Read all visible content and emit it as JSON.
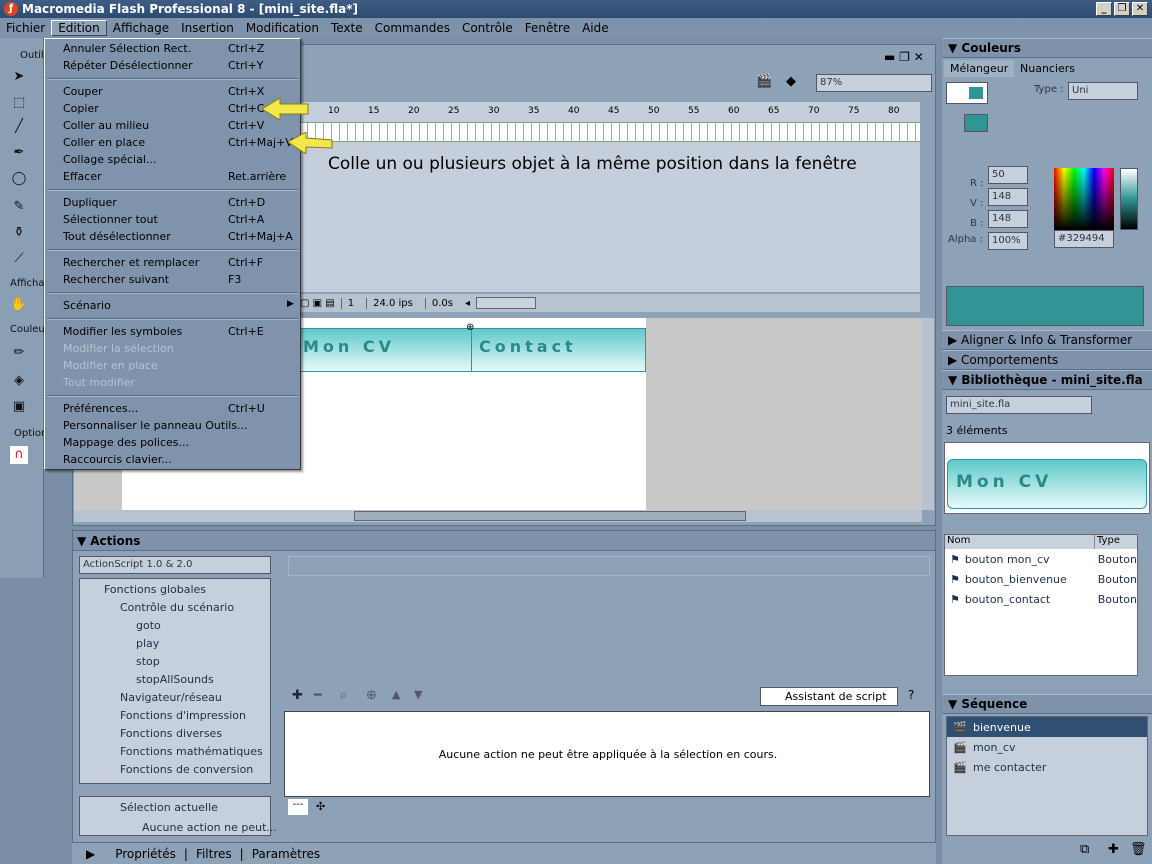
{
  "window": {
    "title": "Macromedia Flash Professional 8 - [mini_site.fla*]"
  },
  "menubar": [
    "Fichier",
    "Edition",
    "Affichage",
    "Insertion",
    "Modification",
    "Texte",
    "Commandes",
    "Contrôle",
    "Fenêtre",
    "Aide"
  ],
  "edit_menu": [
    {
      "label": "Annuler Sélection Rect.",
      "shortcut": "Ctrl+Z",
      "enabled": true
    },
    {
      "label": "Répéter Désélectionner",
      "shortcut": "Ctrl+Y",
      "enabled": true
    },
    {
      "label": "Couper",
      "shortcut": "Ctrl+X",
      "enabled": true
    },
    {
      "label": "Copier",
      "shortcut": "Ctrl+C",
      "enabled": true
    },
    {
      "label": "Coller au milieu",
      "shortcut": "Ctrl+V",
      "enabled": true
    },
    {
      "label": "Coller en place",
      "shortcut": "Ctrl+Maj+V",
      "enabled": true
    },
    {
      "label": "Collage spécial...",
      "shortcut": "",
      "enabled": true
    },
    {
      "label": "Effacer",
      "shortcut": "Ret.arrière",
      "enabled": true
    },
    {
      "label": "Dupliquer",
      "shortcut": "Ctrl+D",
      "enabled": true
    },
    {
      "label": "Sélectionner tout",
      "shortcut": "Ctrl+A",
      "enabled": true
    },
    {
      "label": "Tout désélectionner",
      "shortcut": "Ctrl+Maj+A",
      "enabled": true
    },
    {
      "label": "Rechercher et remplacer",
      "shortcut": "Ctrl+F",
      "enabled": true
    },
    {
      "label": "Rechercher suivant",
      "shortcut": "F3",
      "enabled": true
    },
    {
      "label": "Scénario",
      "shortcut": "",
      "enabled": true
    },
    {
      "label": "Modifier les symboles",
      "shortcut": "Ctrl+E",
      "enabled": true
    },
    {
      "label": "Modifier la sélection",
      "shortcut": "",
      "enabled": false
    },
    {
      "label": "Modifier en place",
      "shortcut": "",
      "enabled": false
    },
    {
      "label": "Tout modifier",
      "shortcut": "",
      "enabled": false
    },
    {
      "label": "Préférences...",
      "shortcut": "Ctrl+U",
      "enabled": true
    },
    {
      "label": "Personnaliser le panneau Outils...",
      "shortcut": "",
      "enabled": true
    },
    {
      "label": "Mappage des polices...",
      "shortcut": "",
      "enabled": true
    },
    {
      "label": "Raccourcis clavier...",
      "shortcut": "",
      "enabled": true
    }
  ],
  "callout": "Colle un ou plusieurs objet à la même position dans la fenêtre",
  "tools": {
    "header_tools": "Outils",
    "header_view": "Affichage",
    "header_colors": "Couleurs",
    "header_options": "Options"
  },
  "timeline": {
    "ruler": [
      "10",
      "15",
      "20",
      "25",
      "30",
      "35",
      "40",
      "45",
      "50",
      "55",
      "60",
      "65",
      "70",
      "75",
      "80"
    ],
    "frame": "1",
    "fps": "24.0 ips",
    "time": "0.0s",
    "zoom": "87%"
  },
  "stage": {
    "btn1": "Mon CV",
    "btn2": "Contact"
  },
  "actions": {
    "title": "Actions",
    "version_select": "ActionScript 1.0 & 2.0",
    "tree": [
      "Fonctions globales",
      "Contrôle du scénario",
      "goto",
      "play",
      "stop",
      "stopAllSounds",
      "Navigateur/réseau",
      "Fonctions d'impression",
      "Fonctions diverses",
      "Fonctions mathématiques",
      "Fonctions de conversion"
    ],
    "selection": "Sélection actuelle",
    "selection_child": "Aucune action ne peut...",
    "assistant": "Assistant de script",
    "empty_msg": "Aucune action ne peut être appliquée à la sélection en cours.",
    "tab": "---"
  },
  "properties_bar": [
    "Propriétés",
    "Filtres",
    "Paramètres"
  ],
  "colors": {
    "title": "Couleurs",
    "tab_mixer": "Mélangeur",
    "tab_swatches": "Nuanciers",
    "type_label": "Type :",
    "type_value": "Uni",
    "r_label": "R :",
    "r": "50",
    "g_label": "V :",
    "g": "148",
    "b_label": "B :",
    "b": "148",
    "alpha_label": "Alpha :",
    "alpha": "100%",
    "hex": "#329494",
    "swatch": "#329494"
  },
  "panels": {
    "align": "Aligner & Info & Transformer",
    "behaviors": "Comportements"
  },
  "library": {
    "title": "Bibliothèque - mini_site.fla",
    "file": "mini_site.fla",
    "count": "3 éléments",
    "preview": "Mon CV",
    "col_name": "Nom",
    "col_type": "Type",
    "items": [
      {
        "name": "bouton mon_cv",
        "type": "Bouton"
      },
      {
        "name": "bouton_bienvenue",
        "type": "Bouton"
      },
      {
        "name": "bouton_contact",
        "type": "Bouton"
      }
    ]
  },
  "scene": {
    "title": "Séquence",
    "items": [
      "bienvenue",
      "mon_cv",
      "me contacter"
    ]
  }
}
